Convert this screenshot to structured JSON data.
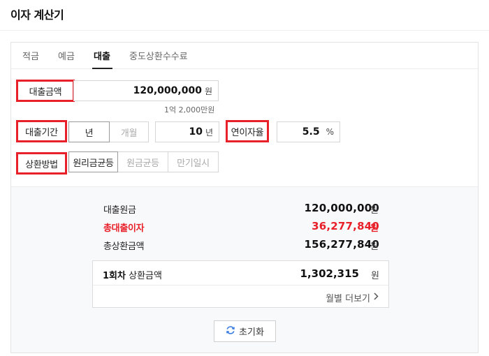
{
  "page": {
    "title": "이자 계산기"
  },
  "tabs": [
    {
      "label": "적금"
    },
    {
      "label": "예금"
    },
    {
      "label": "대출",
      "active": true
    },
    {
      "label": "중도상환수수료"
    }
  ],
  "loan_amount": {
    "label": "대출금액",
    "value": "120,000,000",
    "unit": "원",
    "hint": "1억 2,000만원"
  },
  "loan_period": {
    "label": "대출기간",
    "unit_options": [
      "년",
      "개월"
    ],
    "selected_unit": "년",
    "value": "10",
    "unit": "년"
  },
  "interest_rate": {
    "label": "연이자율",
    "value": "5.5",
    "unit": "%"
  },
  "repayment_method": {
    "label": "상환방법",
    "options": [
      "원리금균등",
      "원금균등",
      "만기일시"
    ],
    "selected": "원리금균등"
  },
  "results": {
    "principal": {
      "label": "대출원금",
      "value": "120,000,000",
      "unit": "원"
    },
    "total_interest": {
      "label": "총대출이자",
      "value": "36,277,840",
      "unit": "원"
    },
    "total_repayment": {
      "label": "총상환금액",
      "value": "156,277,840",
      "unit": "원"
    }
  },
  "installment": {
    "count": "1회차",
    "label": "상환금액",
    "value": "1,302,315",
    "unit": "원",
    "more_label": "월별 더보기"
  },
  "reset_label": "초기화",
  "colors": {
    "highlight": "#e8202a",
    "interest_text": "#e8202a",
    "reset_icon": "#3b7de0"
  },
  "icons": [
    "chevron-right-icon",
    "refresh-icon"
  ]
}
